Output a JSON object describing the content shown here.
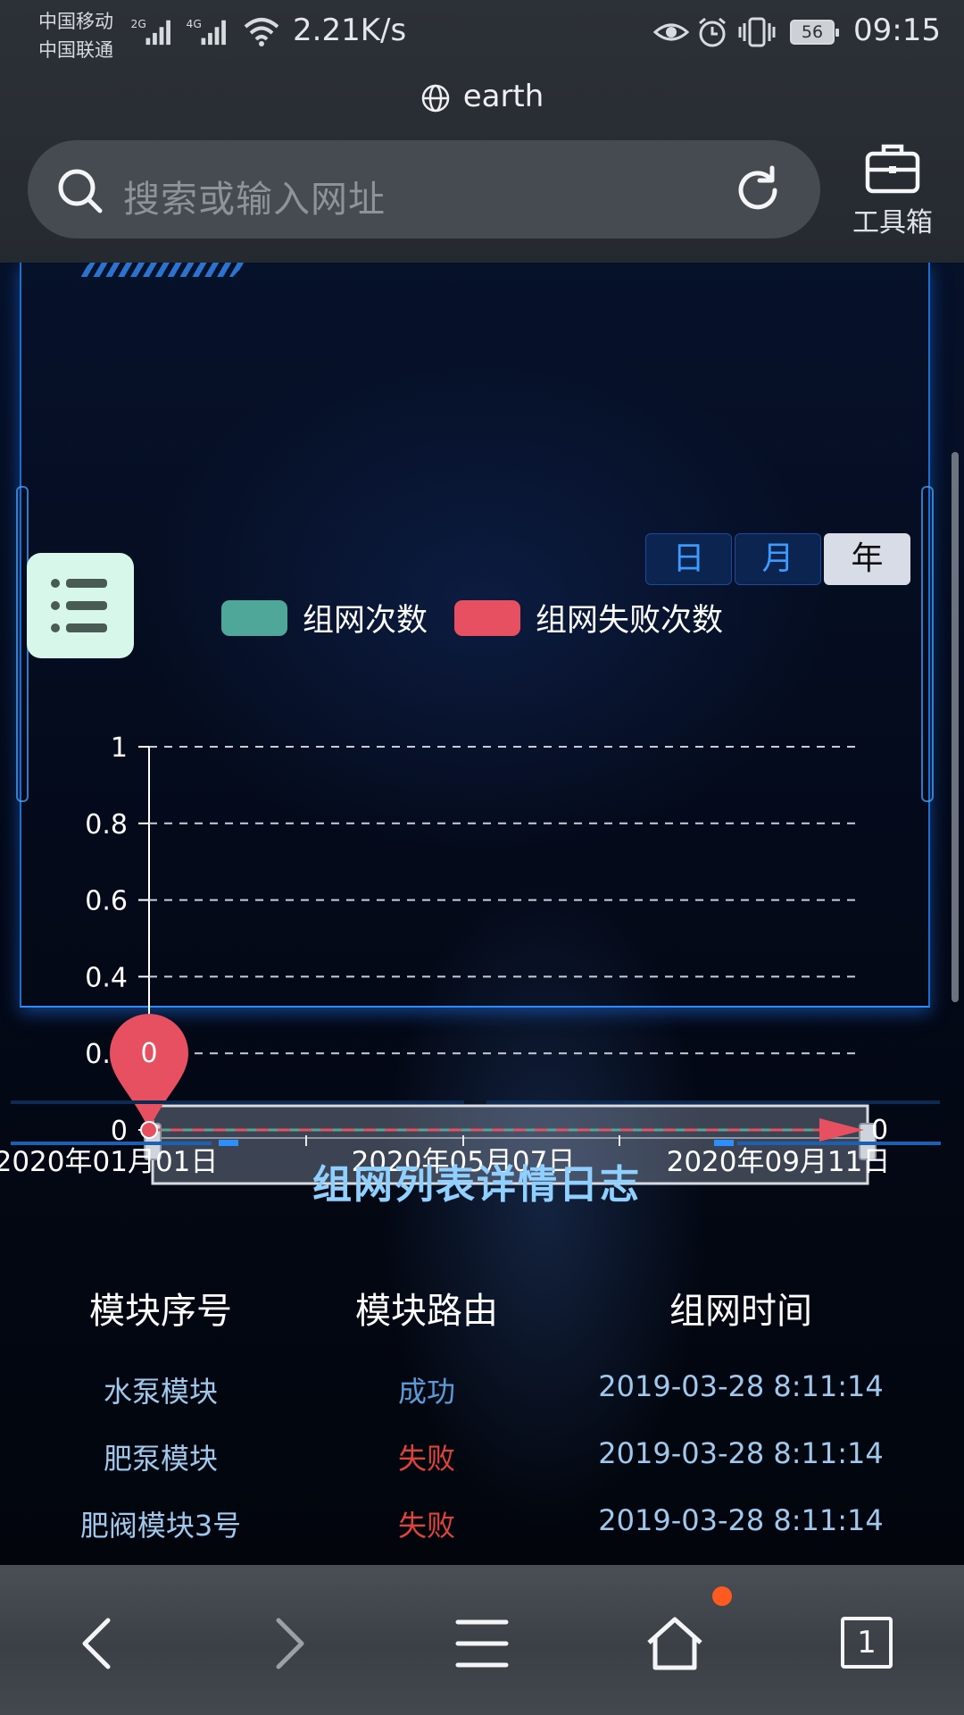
{
  "status_bar": {
    "carrier_1": "中国移动",
    "carrier_2": "中国联通",
    "net_1": "2G",
    "net_2": "4G",
    "speed": "2.21K/s",
    "battery": "56",
    "time": "09:15"
  },
  "browser": {
    "site_title": "earth",
    "search_placeholder": "搜索或输入网址",
    "toolbox_label": "工具箱",
    "tab_count": "1"
  },
  "period_tabs": [
    {
      "label": "日",
      "active": false
    },
    {
      "label": "月",
      "active": false
    },
    {
      "label": "年",
      "active": true
    }
  ],
  "legend": [
    {
      "label": "组网次数",
      "color": "#4fa79a"
    },
    {
      "label": "组网失败次数",
      "color": "#e65060"
    }
  ],
  "chart_data": {
    "type": "line",
    "x": [
      "2020年01月01日",
      "2020年05月07日",
      "2020年09月11日"
    ],
    "series": [
      {
        "name": "组网次数",
        "values": [
          0,
          0,
          0
        ],
        "color": "#4fa79a"
      },
      {
        "name": "组网失败次数",
        "values": [
          0,
          0,
          0
        ],
        "color": "#e65060"
      }
    ],
    "y_ticks": [
      "0",
      "0.2",
      "0.4",
      "0.6",
      "0.8",
      "1"
    ],
    "ylim": [
      0,
      1
    ],
    "markers": [
      {
        "label": "0"
      }
    ],
    "end_label": "0",
    "grid": true,
    "legend_position": "top"
  },
  "log": {
    "title": "组网列表详情日志",
    "columns": [
      "模块序号",
      "模块路由",
      "组网时间"
    ],
    "rows": [
      {
        "module": "水泵模块",
        "route": "成功",
        "time": "2019-03-28 8:11:14",
        "status": "ok"
      },
      {
        "module": "肥泵模块",
        "route": "失败",
        "time": "2019-03-28 8:11:14",
        "status": "fail"
      },
      {
        "module": "肥阀模块3号",
        "route": "失败",
        "time": "2019-03-28 8:11:14",
        "status": "fail"
      }
    ]
  },
  "icons": {
    "back": "chevron-left-icon",
    "forward": "chevron-right-icon",
    "menu": "hamburger-icon",
    "home": "home-icon",
    "tabs": "tabs-icon"
  }
}
